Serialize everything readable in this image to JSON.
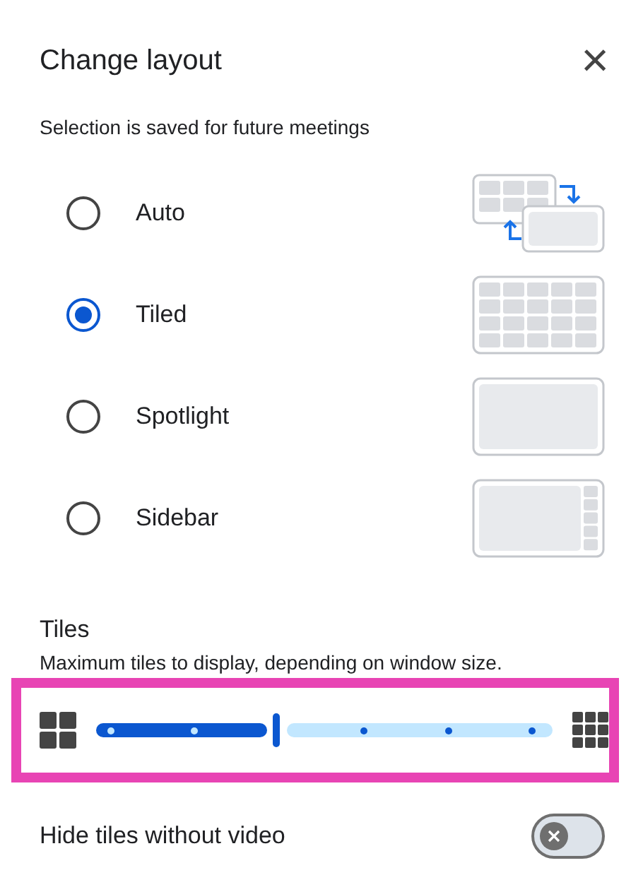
{
  "dialog": {
    "title": "Change layout",
    "close": "×",
    "subtitle": "Selection is saved for future meetings"
  },
  "layouts": [
    {
      "label": "Auto",
      "kind": "auto",
      "selected": false
    },
    {
      "label": "Tiled",
      "kind": "tiled",
      "selected": true
    },
    {
      "label": "Spotlight",
      "kind": "spotlight",
      "selected": false
    },
    {
      "label": "Sidebar",
      "kind": "sidebar",
      "selected": false
    }
  ],
  "tiles": {
    "heading": "Tiles",
    "description": "Maximum tiles to display, depending on window size.",
    "level": 0.4,
    "highlighted": true
  },
  "hide_tiles": {
    "label": "Hide tiles without video",
    "on": false
  }
}
